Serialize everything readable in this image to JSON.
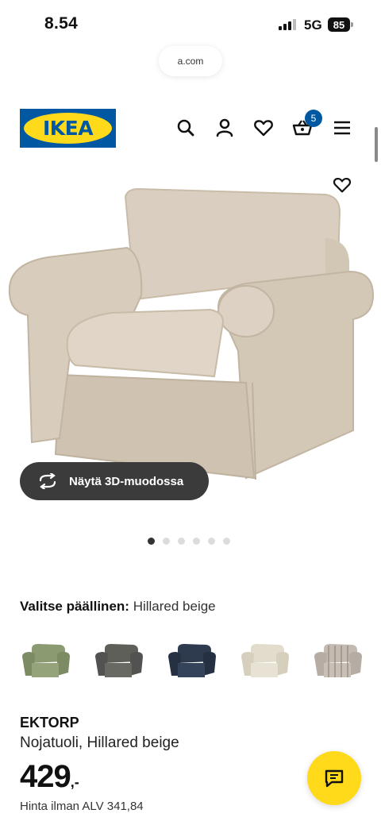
{
  "status_bar": {
    "time": "8.54",
    "network": "5G",
    "battery": "85"
  },
  "browser": {
    "url": "a.com"
  },
  "header": {
    "logo_text": "IKEA",
    "cart_count": "5",
    "icons": [
      "search-icon",
      "account-icon",
      "heart-icon",
      "basket-icon",
      "menu-icon"
    ]
  },
  "product_image": {
    "view_3d_label": "Näytä 3D-muodossa",
    "carousel_dots": 6,
    "active_dot": 1
  },
  "cover": {
    "label": "Valitse päällinen:",
    "selected": "Hillared beige",
    "swatch_colors": [
      "#8c9a72",
      "#5f5f5a",
      "#2e3a4e",
      "#e2dccd",
      "#b8b0a6"
    ]
  },
  "product": {
    "name": "EKTORP",
    "description": "Nojatuoli, Hillared beige",
    "price": "429",
    "price_suffix": ",-",
    "vat_text": "Hinta ilman ALV 341,84"
  },
  "colors": {
    "ikea_blue": "#0058a3",
    "ikea_yellow": "#ffda1a",
    "chair_beige": "#d6cabb"
  }
}
